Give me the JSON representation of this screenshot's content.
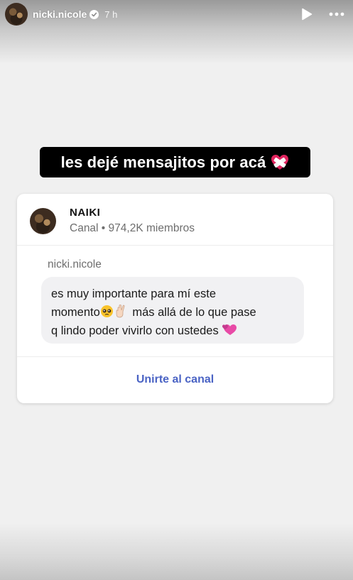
{
  "story": {
    "username": "nicki.nicole",
    "time": "7 h",
    "caption": "les dejé mensajitos por acá"
  },
  "card": {
    "channel_name": "NAIKI",
    "channel_meta": "Canal • 974,2K miembros",
    "author": "nicki.nicole",
    "message_line1": "es muy importante para mí este",
    "message_line2_a": "momento",
    "message_line2_b": " más allá de lo que pase",
    "message_line3": "q lindo poder vivirlo con ustedes ",
    "join_label": "Unirte al canal"
  },
  "colors": {
    "accent": "#4a63c4",
    "caption_bg": "#000000",
    "heart": "#e0245e"
  },
  "icons": [
    "verified-icon",
    "play-icon",
    "more-icon",
    "bandaged-heart-emoji",
    "pleading-face-emoji",
    "crossed-fingers-emoji",
    "two-hearts-emoji"
  ]
}
